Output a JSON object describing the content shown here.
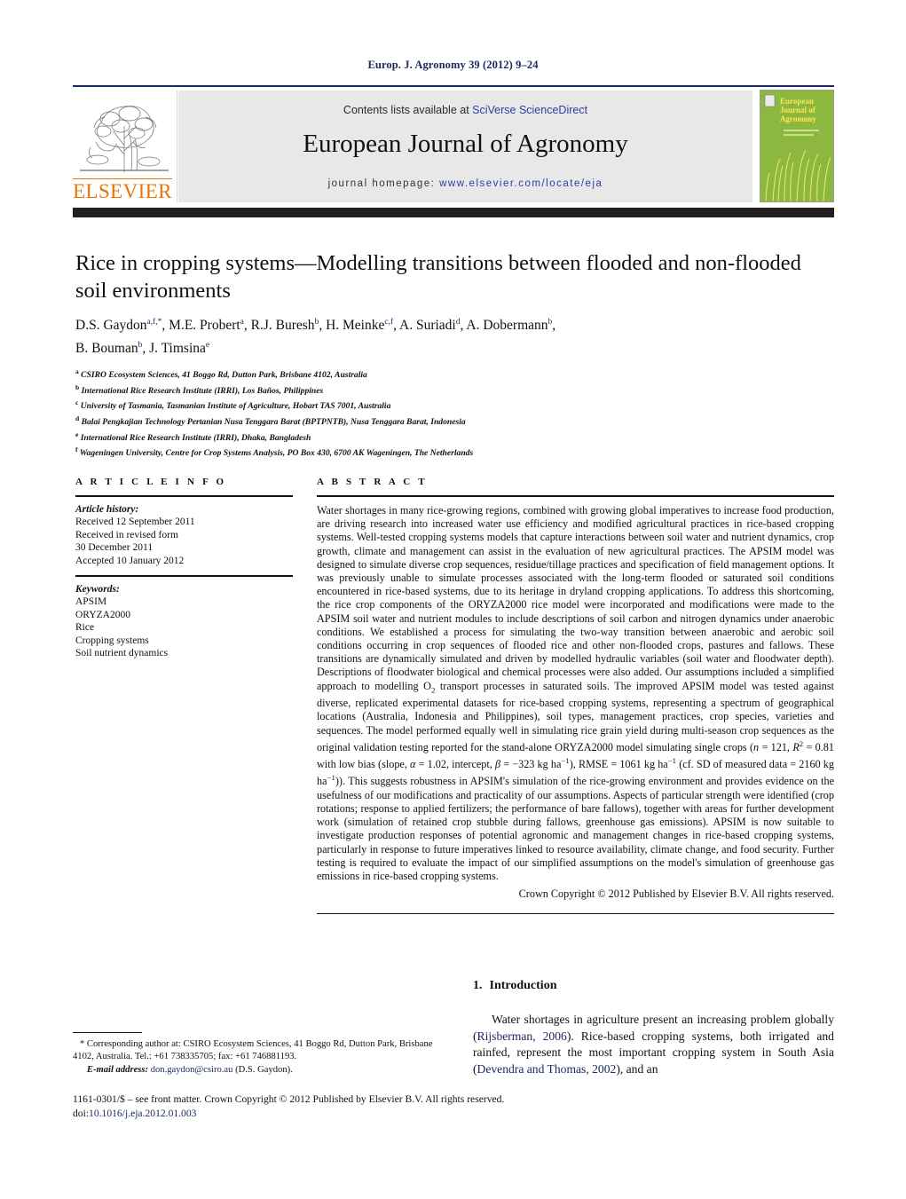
{
  "running_head": "Europ. J. Agronomy 39 (2012) 9–24",
  "masthead": {
    "contents_prefix": "Contents lists available at ",
    "sciencedirect": "SciVerse ScienceDirect",
    "journal_title": "European Journal of Agronomy",
    "homepage_prefix": "journal homepage: ",
    "homepage_url": "www.elsevier.com/locate/eja",
    "publisher": "ELSEVIER",
    "cover_title_line1": "European",
    "cover_title_line2": "Journal of",
    "cover_title_line3": "Agronomy",
    "accent_link_color": "#2b3f9e",
    "elsevier_orange": "#ec7404",
    "cover_green": "#8cb840"
  },
  "article": {
    "title": "Rice in cropping systems—Modelling transitions between flooded and non-flooded soil environments",
    "authors_line1_a": "D.S. Gaydon",
    "authors_line1_a_sup": "a,f,*",
    "authors_line1_b": ", M.E. Probert",
    "authors_line1_b_sup": "a",
    "authors_line1_c": ", R.J. Buresh",
    "authors_line1_c_sup": "b",
    "authors_line1_d": ", H. Meinke",
    "authors_line1_d_sup": "c,f",
    "authors_line1_e": ", A. Suriadi",
    "authors_line1_e_sup": "d",
    "authors_line1_f": ", A. Dobermann",
    "authors_line1_f_sup": "b",
    "authors_line2_a": "B. Bouman",
    "authors_line2_a_sup": "b",
    "authors_line2_b": ", J. Timsina",
    "authors_line2_b_sup": "e",
    "affiliations": [
      {
        "label": "a",
        "text": "CSIRO Ecosystem Sciences, 41 Boggo Rd, Dutton Park, Brisbane 4102, Australia"
      },
      {
        "label": "b",
        "text": "International Rice Research Institute (IRRI), Los Baños, Philippines"
      },
      {
        "label": "c",
        "text": "University of Tasmania, Tasmanian Institute of Agriculture, Hobart TAS 7001, Australia"
      },
      {
        "label": "d",
        "text": "Balai Pengkajian Technology Pertanian Nusa Tenggara Barat (BPTPNTB), Nusa Tenggara Barat, Indonesia"
      },
      {
        "label": "e",
        "text": "International Rice Research Institute (IRRI), Dhaka, Bangladesh"
      },
      {
        "label": "f",
        "text": "Wageningen University, Centre for Crop Systems Analysis, PO Box 430, 6700 AK Wageningen, The Netherlands"
      }
    ]
  },
  "article_info": {
    "heading": "A R T I C L E    I N F O",
    "history_label": "Article history:",
    "history_lines": [
      "Received 12 September 2011",
      "Received in revised form",
      "30 December 2011",
      "Accepted 10 January 2012"
    ],
    "keywords_label": "Keywords:",
    "keywords": [
      "APSIM",
      "ORYZA2000",
      "Rice",
      "Cropping systems",
      "Soil nutrient dynamics"
    ]
  },
  "abstract": {
    "heading": "A B S T R A C T",
    "part1": "Water shortages in many rice-growing regions, combined with growing global imperatives to increase food production, are driving research into increased water use efficiency and modified agricultural practices in rice-based cropping systems. Well-tested cropping systems models that capture interactions between soil water and nutrient dynamics, crop growth, climate and management can assist in the evaluation of new agricultural practices. The APSIM model was designed to simulate diverse crop sequences, residue/tillage practices and specification of field management options. It was previously unable to simulate processes associated with the long-term flooded or saturated soil conditions encountered in rice-based systems, due to its heritage in dryland cropping applications. To address this shortcoming, the rice crop components of the ORYZA2000 rice model were incorporated and modifications were made to the APSIM soil water and nutrient modules to include descriptions of soil carbon and nitrogen dynamics under anaerobic conditions. We established a process for simulating the two-way transition between anaerobic and aerobic soil conditions occurring in crop sequences of flooded rice and other non-flooded crops, pastures and fallows. These transitions are dynamically simulated and driven by modelled hydraulic variables (soil water and floodwater depth). Descriptions of floodwater biological and chemical processes were also added. Our assumptions included a simplified approach to modelling O",
    "o2_sub": "2",
    "part2": " transport processes in saturated soils. The improved APSIM model was tested against diverse, replicated experimental datasets for rice-based cropping systems, representing a spectrum of geographical locations (Australia, Indonesia and Philippines), soil types, management practices, crop species, varieties and sequences. The model performed equally well in simulating rice grain yield during multi-season crop sequences as the original validation testing reported for the stand-alone ORYZA2000 model simulating single crops (",
    "stats_n": "n",
    "stats_n_val": " = 121, ",
    "stats_r": "R",
    "stats_r_sup": "2",
    "stats_r_val": " = 0.81 with low bias (slope, ",
    "stats_alpha": "α",
    "stats_alpha_val": " = 1.02, intercept, ",
    "stats_beta": "β",
    "stats_beta_val": " = −323 kg ha",
    "stats_beta_sup": "−1",
    "stats_rmse": "), RMSE = 1061 kg ha",
    "stats_rmse_sup": "−1",
    "stats_sd": " (cf. SD of measured data = 2160 kg ha",
    "stats_sd_sup": "−1",
    "part3": ")). This suggests robustness in APSIM's simulation of the rice-growing environment and provides evidence on the usefulness of our modifications and practicality of our assumptions. Aspects of particular strength were identified (crop rotations; response to applied fertilizers; the performance of bare fallows), together with areas for further development work (simulation of retained crop stubble during fallows, greenhouse gas emissions). APSIM is now suitable to investigate production responses of potential agronomic and management changes in rice-based cropping systems, particularly in response to future imperatives linked to resource availability, climate change, and food security. Further testing is required to evaluate the impact of our simplified assumptions on the model's simulation of greenhouse gas emissions in rice-based cropping systems.",
    "copyright": "Crown Copyright © 2012 Published by Elsevier B.V. All rights reserved."
  },
  "introduction": {
    "number": "1.",
    "heading": "Introduction",
    "text_a": "Water shortages in agriculture present an increasing problem globally (",
    "cite_1": "Rijsberman, 2006",
    "text_b": "). Rice-based cropping systems, both irrigated and rainfed, represent the most important cropping system in South Asia (",
    "cite_2": "Devendra and Thomas, 2002",
    "text_c": "), and an"
  },
  "footnote": {
    "corresponding_marker": "*",
    "corresponding_text": "Corresponding author at: CSIRO Ecosystem Sciences, 41 Boggo Rd, Dutton Park, Brisbane 4102, Australia. Tel.: +61 738335705; fax: +61 746881193.",
    "email_label": "E-mail address:",
    "email": "don.gaydon@csiro.au",
    "email_owner": "(D.S. Gaydon)."
  },
  "imprint": {
    "line1": "1161-0301/$ – see front matter. Crown Copyright © 2012 Published by Elsevier B.V. All rights reserved.",
    "doi_label": "doi:",
    "doi_value": "10.1016/j.eja.2012.01.003"
  }
}
